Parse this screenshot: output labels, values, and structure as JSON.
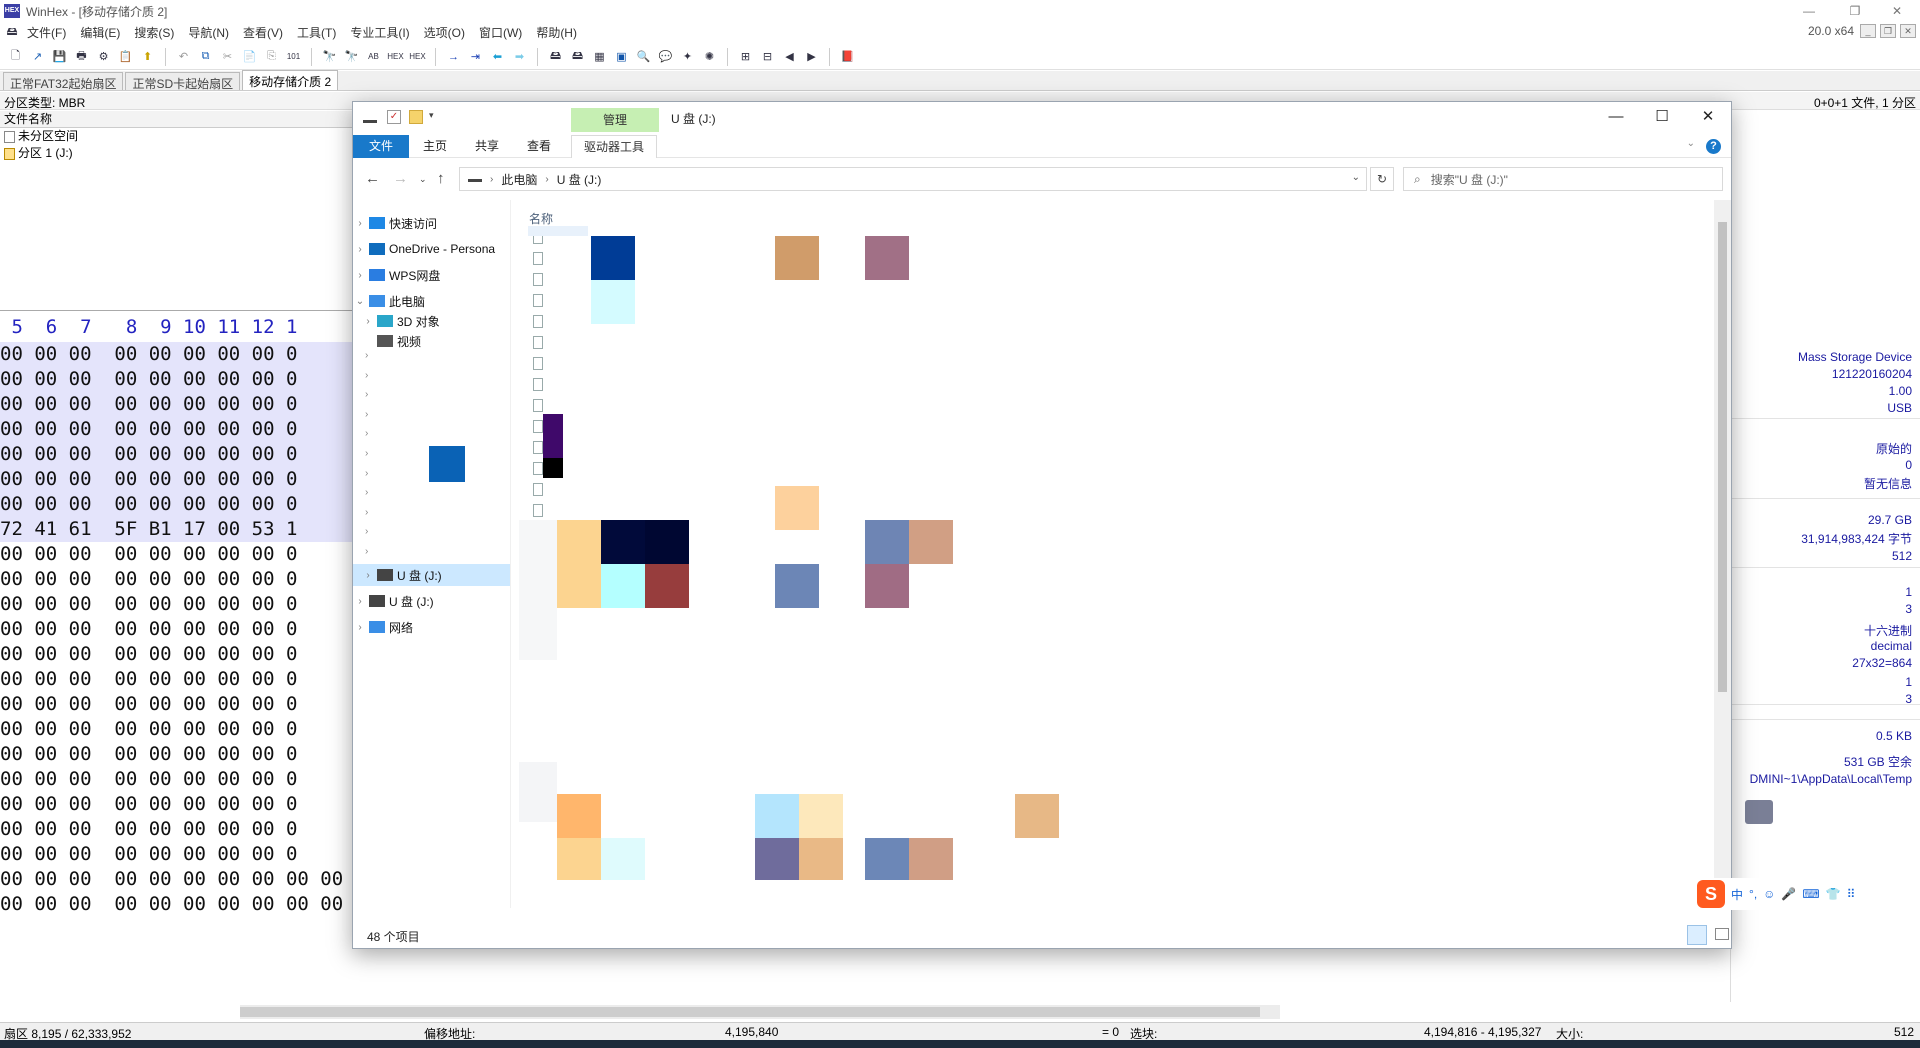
{
  "winhex": {
    "title": "WinHex - [移动存储介质 2]",
    "version": "20.0 x64",
    "menu": [
      "文件(F)",
      "编辑(E)",
      "搜索(S)",
      "导航(N)",
      "查看(V)",
      "工具(T)",
      "专业工具(I)",
      "选项(O)",
      "窗口(W)",
      "帮助(H)"
    ],
    "tabs": [
      "正常FAT32起始扇区",
      "正常SD卡起始扇区",
      "移动存储介质 2"
    ],
    "partition_type": "分区类型: MBR",
    "file_count": "0+0+1 文件, 1 分区",
    "list_header": "文件名称",
    "list_items": [
      "未分区空间",
      "分区 1 (J:)"
    ],
    "hex_header": " 5  6  7   8  9 10 11 12 1",
    "hex_rows": [
      "00 00 00  00 00 00 00 00 0",
      "00 00 00  00 00 00 00 00 0",
      "00 00 00  00 00 00 00 00 0",
      "00 00 00  00 00 00 00 00 0",
      "00 00 00  00 00 00 00 00 0",
      "00 00 00  00 00 00 00 00 0",
      "00 00 00  00 00 00 00 00 0",
      "72 41 61  5F B1 17 00 53 1",
      "00 00 00  00 00 00 00 00 0",
      "00 00 00  00 00 00 00 00 0",
      "00 00 00  00 00 00 00 00 0",
      "00 00 00  00 00 00 00 00 0",
      "00 00 00  00 00 00 00 00 0",
      "00 00 00  00 00 00 00 00 0",
      "00 00 00  00 00 00 00 00 0",
      "00 00 00  00 00 00 00 00 0",
      "00 00 00  00 00 00 00 00 0",
      "00 00 00  00 00 00 00 00 0",
      "00 00 00  00 00 00 00 00 0",
      "00 00 00  00 00 00 00 00 0",
      "00 00 00  00 00 00 00 00 0",
      "00 00 00  00 00 00 00 00 00 00 00 0(",
      "00 00 00  00 00 00 00 00 00 00 00 00  00 00 00 00 00  00 00 00 00 00 00 00"
    ],
    "hex_row_tail": "00 00 00 00 00 00 00",
    "info_panel": [
      "Mass Storage Device",
      "121220160204",
      "1.00",
      "USB",
      "原始的",
      "0",
      "暂无信息",
      "29.7 GB",
      "31,914,983,424 字节",
      "512",
      "1",
      "3",
      "十六进制",
      "decimal",
      "27x32=864",
      "1",
      "3",
      "0.5 KB",
      "531 GB 空余",
      "DMINI~1\\AppData\\Local\\Temp"
    ],
    "status": {
      "sector": "扇区 8,195 / 62,333,952",
      "offset_label": "偏移地址:",
      "offset_value": "4,195,840",
      "eq": "= 0",
      "sel_label": "选块:",
      "sel_value": "4,194,816 - 4,195,327",
      "size_label": "大小:",
      "size_value": "512"
    }
  },
  "explorer": {
    "context_tab": "管理",
    "title": "U 盘 (J:)",
    "ribbon_tabs": [
      "文件",
      "主页",
      "共享",
      "查看",
      "驱动器工具"
    ],
    "address": [
      "此电脑",
      "U 盘 (J:)"
    ],
    "search_placeholder": "搜索\"U 盘 (J:)\"",
    "nav_items": [
      "快速访问",
      "OneDrive - Persona",
      "WPS网盘",
      "此电脑",
      "3D 对象",
      "视频",
      "U 盘 (J:)",
      "U 盘 (J:)",
      "网络"
    ],
    "column_name": "名称",
    "item_count": "48 个项目"
  },
  "ime": {
    "items": [
      "中",
      "°,",
      "☺",
      "🎤",
      "⌨",
      "👕",
      "⠿"
    ]
  },
  "colors": {
    "accent": "#1979ca",
    "hex_highlight": "#e4e4fb",
    "hex_header": "#2323c0",
    "context_tab": "#c6efb3"
  }
}
